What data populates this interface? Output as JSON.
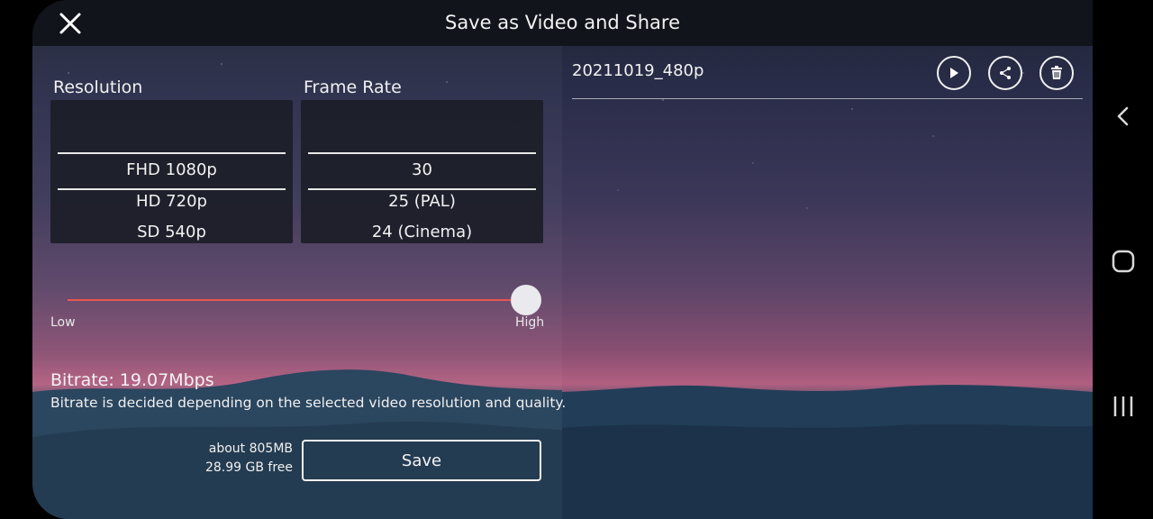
{
  "header": {
    "title": "Save as Video and Share",
    "close_icon": "close-icon"
  },
  "resolution": {
    "label": "Resolution",
    "options": [
      "FHD 1080p",
      "HD 720p",
      "SD 540p"
    ],
    "selected": "FHD 1080p"
  },
  "frame_rate": {
    "label": "Frame Rate",
    "options": [
      "30",
      "25 (PAL)",
      "24 (Cinema)"
    ],
    "selected": "30"
  },
  "quality_slider": {
    "low_label": "Low",
    "high_label": "High",
    "value": 1.0,
    "track_color": "#e8564f"
  },
  "bitrate": {
    "label": "Bitrate: 19.07Mbps",
    "note": "Bitrate is decided depending on the selected video resolution and quality."
  },
  "storage": {
    "estimated_size": "about 805MB",
    "free_space": "28.99 GB free"
  },
  "save_button": {
    "label": "Save"
  },
  "file": {
    "name": "20211019_480p",
    "actions": [
      "play-icon",
      "share-icon",
      "trash-icon"
    ]
  },
  "navbar": {
    "icons": [
      "back-icon",
      "home-icon",
      "recents-icon"
    ]
  }
}
